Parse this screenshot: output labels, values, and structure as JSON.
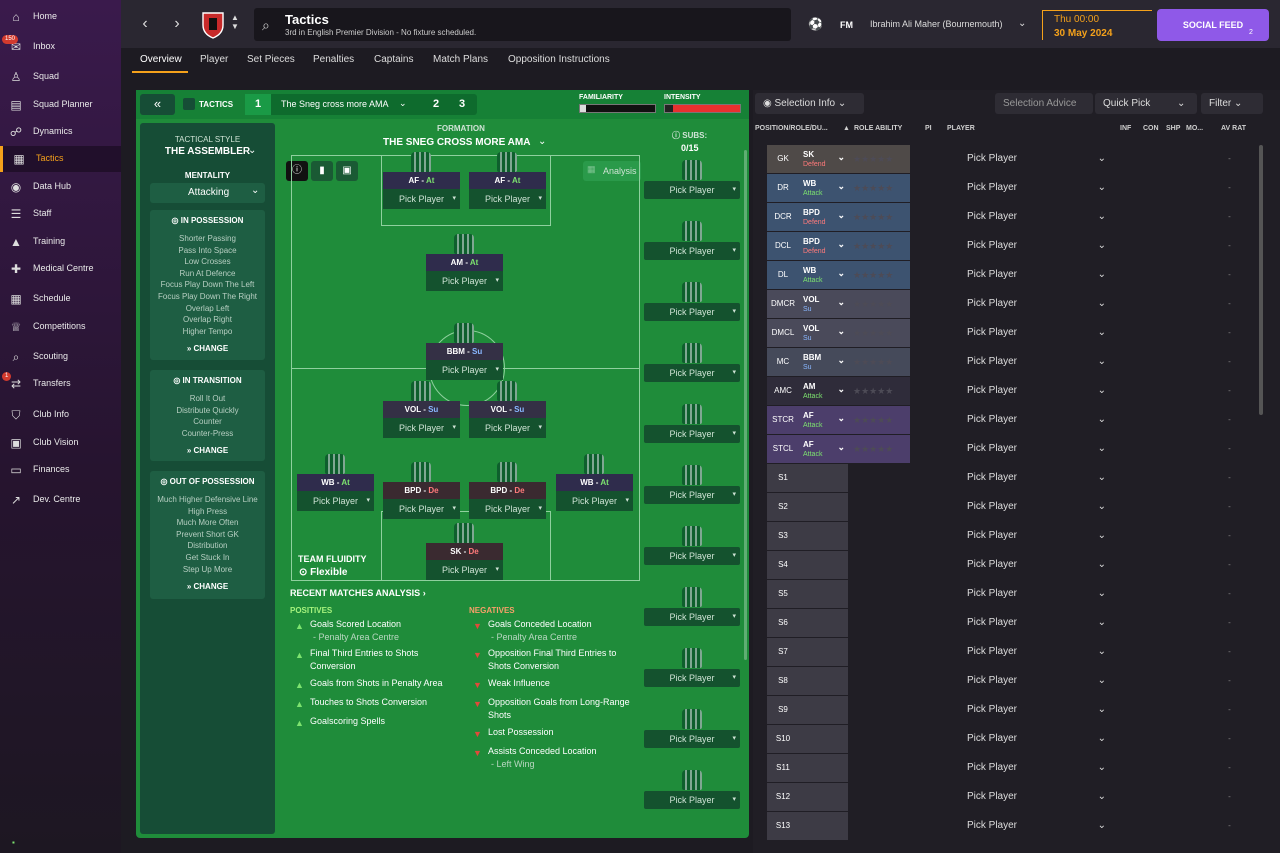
{
  "sidebar": {
    "items": [
      {
        "label": "Home",
        "icon": "home-icon"
      },
      {
        "label": "Inbox",
        "icon": "inbox-icon",
        "badge": "150"
      },
      {
        "label": "Squad",
        "icon": "shirt-icon"
      },
      {
        "label": "Squad Planner",
        "icon": "clipboard-icon"
      },
      {
        "label": "Dynamics",
        "icon": "dynamics-icon"
      },
      {
        "label": "Tactics",
        "icon": "tactics-icon"
      },
      {
        "label": "Data Hub",
        "icon": "data-hub-icon"
      },
      {
        "label": "Staff",
        "icon": "staff-icon"
      },
      {
        "label": "Training",
        "icon": "training-icon"
      },
      {
        "label": "Medical Centre",
        "icon": "medical-icon"
      },
      {
        "label": "Schedule",
        "icon": "calendar-icon"
      },
      {
        "label": "Competitions",
        "icon": "trophy-icon"
      },
      {
        "label": "Scouting",
        "icon": "search-icon"
      },
      {
        "label": "Transfers",
        "icon": "transfers-icon",
        "badge": "1"
      },
      {
        "label": "Club Info",
        "icon": "shield-icon"
      },
      {
        "label": "Club Vision",
        "icon": "briefcase-icon"
      },
      {
        "label": "Finances",
        "icon": "finances-icon"
      },
      {
        "label": "Dev. Centre",
        "icon": "dev-centre-icon"
      }
    ]
  },
  "topbar": {
    "title": "Tactics",
    "subtitle": "3rd in English Premier Division - No fixture scheduled.",
    "fm_label": "FM",
    "manager": "Ibrahim Ali Maher (Bournemouth)",
    "day": "Thu 00:00",
    "date": "30 May 2024",
    "social_feed": "SOCIAL FEED",
    "social_count": "2"
  },
  "tabs": [
    "Overview",
    "Player",
    "Set Pieces",
    "Penalties",
    "Captains",
    "Match Plans",
    "Opposition Instructions"
  ],
  "tactic_bar": {
    "label": "TACTICS",
    "slot_1": "1",
    "name": "The Sneg cross more AMA",
    "slot_2": "2",
    "slot_3": "3",
    "familiarity_label": "FAMILIARITY",
    "intensity_label": "INTENSITY"
  },
  "left_col": {
    "style_label": "TACTICAL STYLE",
    "style": "THE ASSEMBLER",
    "mentality_label": "MENTALITY",
    "mentality": "Attacking",
    "in_possession": {
      "title": "IN POSSESSION",
      "items": [
        "Shorter Passing",
        "Pass Into Space",
        "Low Crosses",
        "Run At Defence",
        "Focus Play Down The Left",
        "Focus Play Down The Right",
        "Overlap Left",
        "Overlap Right",
        "Higher Tempo"
      ],
      "change": "CHANGE"
    },
    "in_transition": {
      "title": "IN TRANSITION",
      "items": [
        "Roll It Out",
        "Distribute Quickly",
        "Counter",
        "Counter-Press"
      ],
      "change": "CHANGE"
    },
    "out_of_possession": {
      "title": "OUT OF POSSESSION",
      "items": [
        "Much Higher Defensive Line",
        "High Press",
        "Much More Often",
        "Prevent Short GK",
        "Distribution",
        "Get Stuck In",
        "Step Up More"
      ],
      "change": "CHANGE"
    }
  },
  "formation": {
    "label": "FORMATION",
    "name": "THE SNEG CROSS MORE AMA",
    "analysis": "Analysis",
    "subs_label": "SUBS:",
    "subs_count": "0/15",
    "team_fluidity_label": "TEAM FLUIDITY",
    "team_fluidity": "Flexible",
    "pick_player": "Pick Player",
    "positions": [
      {
        "role": "AF",
        "duty": "At"
      },
      {
        "role": "AF",
        "duty": "At"
      },
      {
        "role": "AM",
        "duty": "At"
      },
      {
        "role": "BBM",
        "duty": "Su"
      },
      {
        "role": "VOL",
        "duty": "Su"
      },
      {
        "role": "VOL",
        "duty": "Su"
      },
      {
        "role": "WB",
        "duty": "At"
      },
      {
        "role": "BPD",
        "duty": "De"
      },
      {
        "role": "BPD",
        "duty": "De"
      },
      {
        "role": "WB",
        "duty": "At"
      },
      {
        "role": "SK",
        "duty": "De"
      }
    ]
  },
  "analysis": {
    "title": "RECENT MATCHES ANALYSIS",
    "positives_label": "POSITIVES",
    "negatives_label": "NEGATIVES",
    "positives": [
      {
        "text": "Goals Scored Location",
        "sub": "- Penalty Area Centre"
      },
      {
        "text": "Final Third Entries to Shots Conversion",
        "sub": ""
      },
      {
        "text": "Goals from Shots in Penalty Area",
        "sub": ""
      },
      {
        "text": "Touches to Shots Conversion",
        "sub": ""
      },
      {
        "text": "Goalscoring Spells",
        "sub": ""
      }
    ],
    "negatives": [
      {
        "text": "Goals Conceded Location",
        "sub": "- Penalty Area Centre"
      },
      {
        "text": "Opposition Final Third Entries to Shots Conversion",
        "sub": ""
      },
      {
        "text": "Weak Influence",
        "sub": ""
      },
      {
        "text": "Opposition Goals from Long-Range Shots",
        "sub": ""
      },
      {
        "text": "Lost Possession",
        "sub": ""
      },
      {
        "text": "Assists Conceded Location",
        "sub": "- Left Wing"
      }
    ]
  },
  "right": {
    "selection_info": "Selection Info",
    "selection_advice": "Selection Advice",
    "quick_pick": "Quick Pick",
    "filter": "Filter",
    "headers": {
      "position": "POSITION/ROLE/DU...",
      "role_ability": "ROLE ABILITY",
      "pi": "PI",
      "player": "PLAYER",
      "inf": "INF",
      "con": "CON",
      "shp": "SHP",
      "mo": "MO...",
      "av_rat": "AV RAT"
    },
    "rows": [
      {
        "pos": "GK",
        "role": "SK",
        "duty": "Defend",
        "tint": "#4f4a48",
        "duty_color": "#ff7a7a"
      },
      {
        "pos": "DR",
        "role": "WB",
        "duty": "Attack",
        "tint": "#3d5370",
        "duty_color": "#7de36f"
      },
      {
        "pos": "DCR",
        "role": "BPD",
        "duty": "Defend",
        "tint": "#3d5370",
        "duty_color": "#ff7a7a"
      },
      {
        "pos": "DCL",
        "role": "BPD",
        "duty": "Defend",
        "tint": "#3d5370",
        "duty_color": "#ff7a7a"
      },
      {
        "pos": "DL",
        "role": "WB",
        "duty": "Attack",
        "tint": "#3d5370",
        "duty_color": "#7de36f"
      },
      {
        "pos": "DMCR",
        "role": "VOL",
        "duty": "Su",
        "tint": "#4a4a5a",
        "duty_color": "#89b7ff"
      },
      {
        "pos": "DMCL",
        "role": "VOL",
        "duty": "Su",
        "tint": "#4a4a5a",
        "duty_color": "#89b7ff"
      },
      {
        "pos": "MC",
        "role": "BBM",
        "duty": "Su",
        "tint": "#454a5a",
        "duty_color": "#89b7ff"
      },
      {
        "pos": "AMC",
        "role": "AM",
        "duty": "Attack",
        "tint": "#2f2c3a",
        "duty_color": "#7de36f"
      },
      {
        "pos": "STCR",
        "role": "AF",
        "duty": "Attack",
        "tint": "#4c3e6b",
        "duty_color": "#7de36f"
      },
      {
        "pos": "STCL",
        "role": "AF",
        "duty": "Attack",
        "tint": "#4c3e6b",
        "duty_color": "#7de36f"
      },
      {
        "pos": "S1"
      },
      {
        "pos": "S2"
      },
      {
        "pos": "S3"
      },
      {
        "pos": "S4"
      },
      {
        "pos": "S5"
      },
      {
        "pos": "S6"
      },
      {
        "pos": "S7"
      },
      {
        "pos": "S8"
      },
      {
        "pos": "S9"
      },
      {
        "pos": "S10"
      },
      {
        "pos": "S11"
      },
      {
        "pos": "S12"
      },
      {
        "pos": "S13"
      }
    ],
    "pick_player": "Pick Player",
    "dash": "-"
  },
  "colors": {
    "accent": "#f4a11b",
    "social": "#8f59e8",
    "pitch": "#1f8c3a"
  }
}
